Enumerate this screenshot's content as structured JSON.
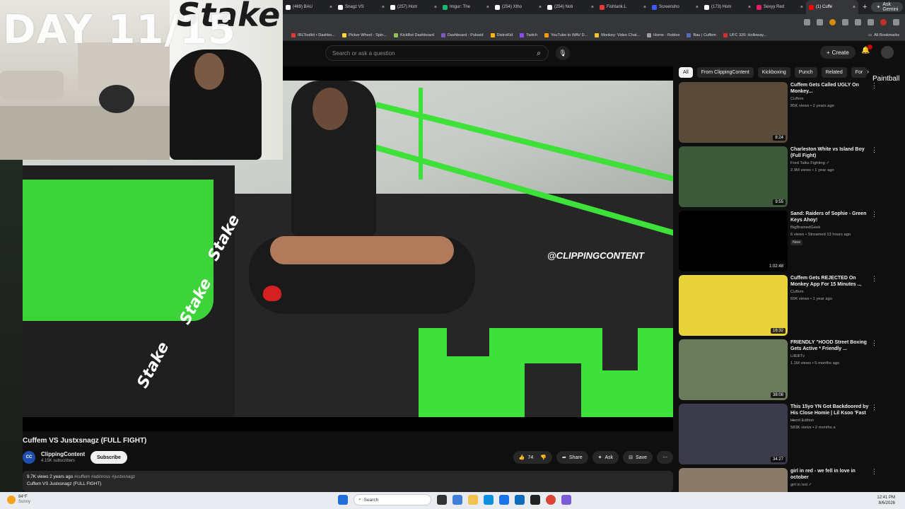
{
  "browser": {
    "tabs": [
      {
        "label": "(469) BAU",
        "color": "#ffffff"
      },
      {
        "label": "Snagz VS",
        "color": "#ffffff"
      },
      {
        "label": "(257) Hom",
        "color": "#ffffff"
      },
      {
        "label": "Imgur: The",
        "color": "#1bb76e"
      },
      {
        "label": "(254) Xtho",
        "color": "#ffffff"
      },
      {
        "label": "(254) Noti",
        "color": "#ffffff"
      },
      {
        "label": "Fishtank.L",
        "color": "#e53935"
      },
      {
        "label": "Screensho",
        "color": "#3d5afe"
      },
      {
        "label": "(173) Hom",
        "color": "#ffffff"
      },
      {
        "label": "Sexyy Red",
        "color": "#e91e63"
      },
      {
        "label": "(1) Cuffe",
        "color": "#ff0000"
      }
    ],
    "active_tab_index": 10,
    "ask_gemini": "Ask Gemini",
    "bookmarks": [
      {
        "label": "IRLToolkit • Dashbo...",
        "color": "#e53935"
      },
      {
        "label": "Picker Wheel - Spin...",
        "color": "#fdd835"
      },
      {
        "label": "KickBot Dashboard",
        "color": "#8bc34a"
      },
      {
        "label": "Dashboard - Pulsoid",
        "color": "#7e57c2"
      },
      {
        "label": "DistroKid",
        "color": "#ffb300"
      },
      {
        "label": "Twitch",
        "color": "#9146ff"
      },
      {
        "label": "YouTube to WAV D...",
        "color": "#ff9800"
      },
      {
        "label": "Monkey: Video Chat...",
        "color": "#fbc02d"
      },
      {
        "label": "Home - Roblox",
        "color": "#9e9e9e"
      },
      {
        "label": "Bau | Cuffem",
        "color": "#5c6bc0"
      },
      {
        "label": "UFC 326: Holloway...",
        "color": "#d32f2f"
      }
    ],
    "all_bookmarks": "All Bookmarks"
  },
  "overlay": {
    "day_text": "DAY 11/15",
    "bg_logo": "Stake"
  },
  "youtube": {
    "search_placeholder": "Search or ask a question",
    "create_label": "Create",
    "video": {
      "watermark": "@CLIPPINGCONTENT",
      "brand_text": "Stake",
      "title": "Cuffem VS Justxsnagz (FULL FIGHT)",
      "channel": "ClippingContent",
      "channel_initials": "CC",
      "subscribers": "4.15K subscribers",
      "subscribe_label": "Subscribe",
      "likes": "74",
      "share_label": "Share",
      "ask_label": "Ask",
      "save_label": "Save",
      "views_line": "9.7K views  2 years ago",
      "tags": "#cuffem #adinross #justxsnagz",
      "desc_line": "Cuffem VS Justxsnagz (FULL FIGHT)"
    },
    "chips": [
      "All",
      "From ClippingContent",
      "Kickboxing",
      "Punch",
      "Related",
      "For"
    ],
    "side_overlay_text": "Paintball",
    "recommendations": [
      {
        "title": "Cuffem Gets Called UGLY On Monkey...",
        "channel": "Cuffem",
        "meta": "85K views • 2 years ago",
        "duration": "8:24",
        "thumb": "#5a4a3a",
        "badge": ""
      },
      {
        "title": "Charleston White vs Island Boy (Full Fight)",
        "channel": "Fred Talks Fighting ✓",
        "meta": "2.9M views • 1 year ago",
        "duration": "9:55",
        "thumb": "#3c5a3a",
        "badge": ""
      },
      {
        "title": "Sand: Raiders of Sophie - Green Keys Ahoy!",
        "channel": "BigBrainedGeek",
        "meta": "6 views • Streamed 13 hours ago",
        "duration": "1:02:48",
        "thumb": "#000000",
        "badge": "New"
      },
      {
        "title": "Cuffem Gets REJECTED On Monkey App For 15 Minutes ...",
        "channel": "Cuffem",
        "meta": "69K views • 1 year ago",
        "duration": "16:32",
        "thumb": "#e8d43a",
        "badge": ""
      },
      {
        "title": "FRIENDLY \"HOOD Street Boxing Gets Active * Friendly ...",
        "channel": "LilElliTv",
        "meta": "1.1M views • 5 months ago",
        "duration": "38:08",
        "thumb": "#6a7a5a",
        "badge": ""
      },
      {
        "title": "This 15yo YN Got Backdoored by His Close Homie | Lil Ksoo 'Fast ...",
        "channel": "Hood Edition",
        "meta": "583K views • 2 months a",
        "duration": "34:27",
        "thumb": "#3a3a4a",
        "badge": ""
      },
      {
        "title": "girl in red - we fell in love in october",
        "channel": "girl in red ✓",
        "meta": "",
        "duration": "",
        "thumb": "#8a7a6a",
        "badge": ""
      }
    ]
  },
  "taskbar": {
    "temp": "84°F",
    "condition": "Sunny",
    "search_label": "Search",
    "time": "12:41 PM",
    "date": "8/6/2026"
  }
}
